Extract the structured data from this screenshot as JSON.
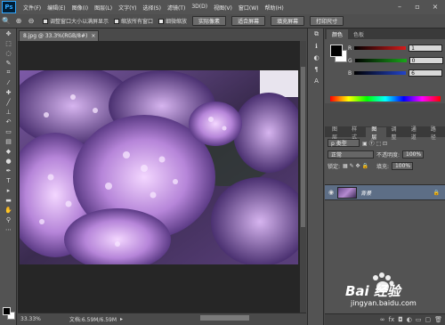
{
  "app": {
    "logo": "Ps"
  },
  "menu": [
    "文件(F)",
    "编辑(E)",
    "图像(I)",
    "图层(L)",
    "文字(Y)",
    "选择(S)",
    "滤镜(T)",
    "3D(D)",
    "视图(V)",
    "窗口(W)",
    "帮助(H)"
  ],
  "options": {
    "check1": "调整窗口大小以满屏显示",
    "check2": "缩放所有窗口",
    "check3": "细微缩放",
    "btn_actual": "实际像素",
    "btn_fit": "适合屏幕",
    "btn_fill": "填充屏幕",
    "btn_print": "打印尺寸"
  },
  "document": {
    "tab": "8.jpg @ 33.3%(RGB/8#)",
    "close": "×"
  },
  "status": {
    "zoom": "33.33%",
    "doc": "文档:6.59M/6.59M",
    "arrow": "▸"
  },
  "color_panel": {
    "tabs": [
      "颜色",
      "色板"
    ],
    "r_label": "R",
    "r": "1",
    "g_label": "G",
    "g": "0",
    "b_label": "B",
    "b": "6",
    "red_hex": "#d61b1b",
    "green_hex": "#1aa61a",
    "blue_hex": "#2244cc"
  },
  "layers_panel": {
    "tabs": [
      "图层",
      "样式",
      "图层",
      "调整",
      "通道",
      "路径"
    ],
    "kind": "p 类型",
    "blend": "正常",
    "opacity_label": "不透明度:",
    "opacity": "100%",
    "lock_label": "锁定:",
    "fill_label": "填充:",
    "fill": "100%",
    "layer_name": "背景"
  },
  "watermark": {
    "brand": "Bai 经验",
    "url": "jingyan.baidu.com"
  }
}
